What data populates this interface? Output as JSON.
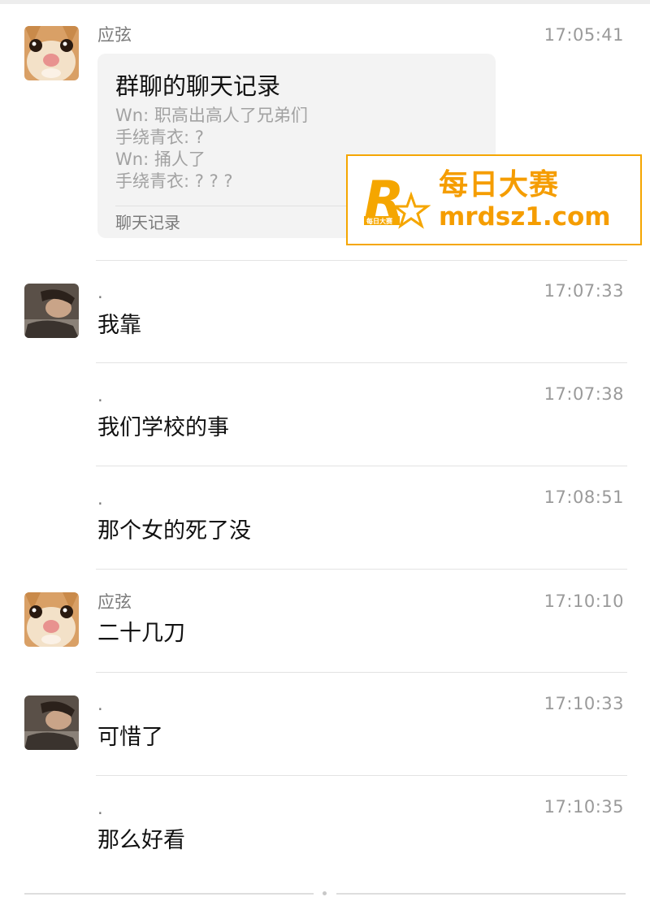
{
  "messages": [
    {
      "sender": "应弦",
      "time": "17:05:41",
      "avatar_icon": "cat-avatar-icon",
      "card": {
        "title": "群聊的聊天记录",
        "lines": [
          "Wn: 职高出高人了兄弟们",
          "手绕青衣: ?",
          "Wn: 捅人了",
          "手绕青衣: ? ? ?"
        ],
        "footer": "聊天记录"
      }
    },
    {
      "sender": ".",
      "time": "17:07:33",
      "text": "我靠",
      "avatar_icon": "girl-photo-avatar-icon"
    },
    {
      "sender": ".",
      "time": "17:07:38",
      "text": "我们学校的事"
    },
    {
      "sender": ".",
      "time": "17:08:51",
      "text": "那个女的死了没"
    },
    {
      "sender": "应弦",
      "time": "17:10:10",
      "text": "二十几刀",
      "avatar_icon": "cat-avatar-icon"
    },
    {
      "sender": ".",
      "time": "17:10:33",
      "text": "可惜了",
      "avatar_icon": "girl-photo-avatar-icon"
    },
    {
      "sender": ".",
      "time": "17:10:35",
      "text": "那么好看"
    }
  ],
  "watermark": {
    "logo_text": "R",
    "logo_subtext": "每日大赛",
    "title": "每日大赛",
    "url": "mrdsz1.com",
    "color": "#f59d00"
  }
}
